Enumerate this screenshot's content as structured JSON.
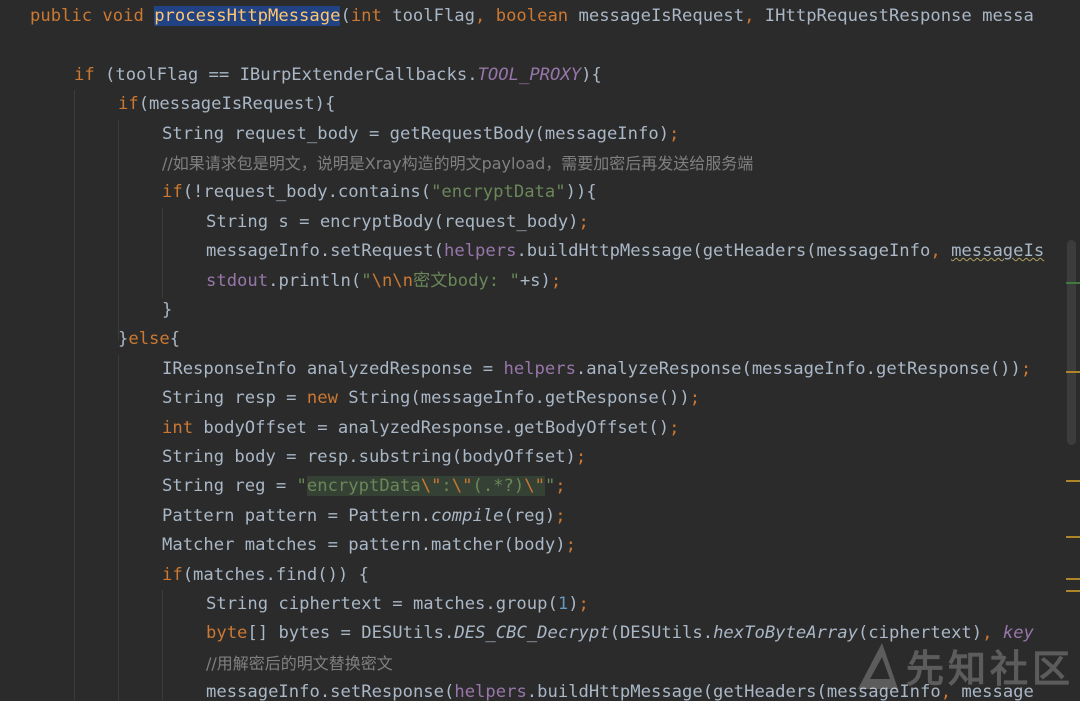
{
  "code_lines": [
    {
      "indent": 0,
      "tokens": [
        {
          "t": "public void ",
          "c": "kw"
        },
        {
          "t": "processHttpMessage",
          "c": "fn hl"
        },
        {
          "t": "(",
          "c": ""
        },
        {
          "t": "int ",
          "c": "kw"
        },
        {
          "t": "toolFlag",
          "c": ""
        },
        {
          "t": ", ",
          "c": "kw"
        },
        {
          "t": "boolean ",
          "c": "kw"
        },
        {
          "t": "messageIsRequest",
          "c": ""
        },
        {
          "t": ", ",
          "c": "kw"
        },
        {
          "t": "IHttpRequestResponse messa",
          "c": ""
        }
      ]
    },
    {
      "indent": 0,
      "tokens": []
    },
    {
      "indent": 1,
      "tokens": [
        {
          "t": "if ",
          "c": "kw"
        },
        {
          "t": "(toolFlag == IBurpExtenderCallbacks.",
          "c": ""
        },
        {
          "t": "TOOL_PROXY",
          "c": "fld it"
        },
        {
          "t": "){",
          "c": ""
        }
      ]
    },
    {
      "indent": 2,
      "tokens": [
        {
          "t": "if",
          "c": "kw"
        },
        {
          "t": "(messageIsRequest){",
          "c": ""
        }
      ]
    },
    {
      "indent": 3,
      "tokens": [
        {
          "t": "String request_body = getRequestBody(messageInfo)",
          "c": ""
        },
        {
          "t": ";",
          "c": "kw"
        }
      ]
    },
    {
      "indent": 3,
      "tokens": [
        {
          "t": "//如果请求包是明文，说明是Xray构造的明文payload，需要加密后再发送给服务端",
          "c": "cm"
        }
      ]
    },
    {
      "indent": 3,
      "tokens": [
        {
          "t": "if",
          "c": "kw"
        },
        {
          "t": "(!request_body.contains(",
          "c": ""
        },
        {
          "t": "\"encryptData\"",
          "c": "st"
        },
        {
          "t": ")){",
          "c": ""
        }
      ]
    },
    {
      "indent": 4,
      "tokens": [
        {
          "t": "String s = encryptBody(request_body)",
          "c": ""
        },
        {
          "t": ";",
          "c": "kw"
        }
      ]
    },
    {
      "indent": 4,
      "tokens": [
        {
          "t": "messageInfo.setRequest(",
          "c": ""
        },
        {
          "t": "helpers",
          "c": "fld"
        },
        {
          "t": ".buildHttpMessage(getHeaders(messageInfo",
          "c": ""
        },
        {
          "t": ", ",
          "c": "kw"
        },
        {
          "t": "messageIs",
          "c": "warn"
        }
      ]
    },
    {
      "indent": 4,
      "tokens": [
        {
          "t": "stdout",
          "c": "fld"
        },
        {
          "t": ".println(",
          "c": ""
        },
        {
          "t": "\"",
          "c": "st"
        },
        {
          "t": "\\n\\n",
          "c": "esc"
        },
        {
          "t": "密文body: \"",
          "c": "st"
        },
        {
          "t": "+s)",
          "c": ""
        },
        {
          "t": ";",
          "c": "kw"
        }
      ]
    },
    {
      "indent": 3,
      "tokens": [
        {
          "t": "}",
          "c": ""
        }
      ]
    },
    {
      "indent": 2,
      "tokens": [
        {
          "t": "}",
          "c": ""
        },
        {
          "t": "else",
          "c": "kw"
        },
        {
          "t": "{",
          "c": ""
        }
      ]
    },
    {
      "indent": 3,
      "tokens": [
        {
          "t": "IResponseInfo analyzedResponse = ",
          "c": ""
        },
        {
          "t": "helpers",
          "c": "fld"
        },
        {
          "t": ".analyzeResponse(messageInfo.getResponse())",
          "c": ""
        },
        {
          "t": ";",
          "c": "kw"
        }
      ]
    },
    {
      "indent": 3,
      "tokens": [
        {
          "t": "String resp = ",
          "c": ""
        },
        {
          "t": "new ",
          "c": "kw"
        },
        {
          "t": "String(messageInfo.getResponse())",
          "c": ""
        },
        {
          "t": ";",
          "c": "kw"
        }
      ]
    },
    {
      "indent": 3,
      "tokens": [
        {
          "t": "int ",
          "c": "kw"
        },
        {
          "t": "bodyOffset = analyzedResponse.getBodyOffset()",
          "c": ""
        },
        {
          "t": ";",
          "c": "kw"
        }
      ]
    },
    {
      "indent": 3,
      "tokens": [
        {
          "t": "String body = resp.substring(bodyOffset)",
          "c": ""
        },
        {
          "t": ";",
          "c": "kw"
        }
      ]
    },
    {
      "indent": 3,
      "tokens": [
        {
          "t": "String reg = ",
          "c": ""
        },
        {
          "t": "\"",
          "c": "st"
        },
        {
          "t": "encryptData",
          "c": "st regex"
        },
        {
          "t": "\\\"",
          "c": "esc regex"
        },
        {
          "t": ":",
          "c": "st regex"
        },
        {
          "t": "\\\"",
          "c": "esc regex"
        },
        {
          "t": "(.*?)",
          "c": "st regex"
        },
        {
          "t": "\\\"",
          "c": "esc regex"
        },
        {
          "t": "\"",
          "c": "st"
        },
        {
          "t": ";",
          "c": "kw"
        }
      ]
    },
    {
      "indent": 3,
      "tokens": [
        {
          "t": "Pattern pattern = Pattern.",
          "c": ""
        },
        {
          "t": "compile",
          "c": "it"
        },
        {
          "t": "(reg)",
          "c": ""
        },
        {
          "t": ";",
          "c": "kw"
        }
      ]
    },
    {
      "indent": 3,
      "tokens": [
        {
          "t": "Matcher matches = pattern.matcher(body)",
          "c": ""
        },
        {
          "t": ";",
          "c": "kw"
        }
      ]
    },
    {
      "indent": 3,
      "tokens": [
        {
          "t": "if",
          "c": "kw"
        },
        {
          "t": "(matches.find()) {",
          "c": ""
        }
      ]
    },
    {
      "indent": 4,
      "tokens": [
        {
          "t": "String ciphertext = matches.group(",
          "c": ""
        },
        {
          "t": "1",
          "c": "num"
        },
        {
          "t": ")",
          "c": ""
        },
        {
          "t": ";",
          "c": "kw"
        }
      ]
    },
    {
      "indent": 4,
      "tokens": [
        {
          "t": "byte",
          "c": "kw"
        },
        {
          "t": "[] bytes = DESUtils.",
          "c": ""
        },
        {
          "t": "DES_CBC_Decrypt",
          "c": "it"
        },
        {
          "t": "(DESUtils.",
          "c": ""
        },
        {
          "t": "hexToByteArray",
          "c": "it"
        },
        {
          "t": "(ciphertext)",
          "c": ""
        },
        {
          "t": ", ",
          "c": "kw"
        },
        {
          "t": "key",
          "c": "fld it"
        }
      ]
    },
    {
      "indent": 4,
      "tokens": [
        {
          "t": "//用解密后的明文替换密文",
          "c": "cm"
        }
      ]
    },
    {
      "indent": 4,
      "tokens": [
        {
          "t": "messageInfo.setResponse(",
          "c": ""
        },
        {
          "t": "helpers",
          "c": "fld"
        },
        {
          "t": ".buildHttpMessage(getHeaders(messageInfo",
          "c": ""
        },
        {
          "t": ", ",
          "c": "kw"
        },
        {
          "t": "message",
          "c": ""
        }
      ]
    }
  ],
  "watermark": {
    "text": "先知社区"
  },
  "colors": {
    "background": "#2b2b2b",
    "keyword": "#cc7832",
    "method": "#ffc66d",
    "string": "#6a8759",
    "field": "#9876aa",
    "comment": "#808080",
    "number": "#6897bb",
    "default": "#a9b7c6",
    "selection": "#214283"
  }
}
